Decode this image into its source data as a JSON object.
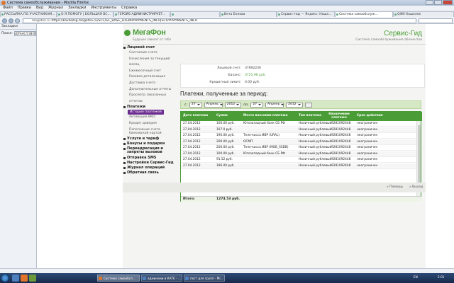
{
  "window": {
    "title": "Система самообслуживания - Mozilla Firefox"
  },
  "menu": [
    "Файл",
    "Правка",
    "Вид",
    "Журнал",
    "Закладки",
    "Инструменты",
    "Справка"
  ],
  "tabs": [
    {
      "label": "РАССЫЛКА ПО УЧАСТНИКАМ...",
      "active": false
    },
    {
      "label": "О Я ПОМОГУ | БОЛЬШАЯ ВС...",
      "active": false
    },
    {
      "label": "ГЕРОЙ0 АДМИНИСТРИРУЕТ...",
      "active": false
    },
    {
      "label": "",
      "active": false
    },
    {
      "label": "Вета Белова",
      "active": false
    },
    {
      "label": "Сервис-гид — Яндекс: Нашл...",
      "active": false
    },
    {
      "label": "Система самообслуж...",
      "active": true
    },
    {
      "label": "QIWI Кошелек",
      "active": false
    }
  ],
  "nav": {
    "host": "megafon.ru",
    "url": "https://kavkazsg.megafon.ru/SCC/SC_BASE_LOGIN#PAYMENTS_INFO|SCP/#PAYMENTS_INFO"
  },
  "sidebar": {
    "title": "Закладки",
    "search_label": "Поиск:",
    "search_value": "sDl%AC/1383051862495I"
  },
  "brand": {
    "name": "МегаФон",
    "slogan": "Будущее зависит от тебя",
    "service": "Сервис-Гид",
    "service_sub": "Система самообслуживания абонентов"
  },
  "left_menu": [
    {
      "head": "Лицевой счет",
      "items": [
        {
          "label": "Состояние счета"
        },
        {
          "label": "Начисления за текущий месяц"
        },
        {
          "label": "Ежемесячный счет"
        },
        {
          "label": "Разовая детализация"
        },
        {
          "label": "Доставка счета"
        },
        {
          "label": "Дополнительные отчеты"
        },
        {
          "label": "Просмотр заказанных отчетов"
        }
      ]
    },
    {
      "head": "Платежи",
      "items": [
        {
          "label": "История платежей",
          "active": true
        },
        {
          "label": "Активация ВКО"
        },
        {
          "label": "Кредит доверия"
        },
        {
          "label": "Пополнение счета банковской картой"
        }
      ]
    },
    {
      "head": "Услуги и тариф",
      "items": []
    },
    {
      "head": "Бонусы и подарки",
      "items": []
    },
    {
      "head": "Переадресация и запреты вызовов",
      "items": []
    },
    {
      "head": "Отправка SMS",
      "items": []
    },
    {
      "head": "Настройки Сервис-Гид",
      "items": []
    },
    {
      "head": "Журнал операций",
      "items": []
    },
    {
      "head": "Обратная связь",
      "items": []
    }
  ],
  "account": {
    "rows": [
      {
        "k": "Лицевой счет:",
        "v": "37892236",
        "green": false
      },
      {
        "k": "Баланс:",
        "v": "3725.96 руб.",
        "green": true
      },
      {
        "k": "Кредитный лимит:",
        "v": "0.00 руб.",
        "green": false
      }
    ]
  },
  "payments": {
    "heading": "Платежи, полученные за период:",
    "filter": {
      "from_label": "с:",
      "to_label": "по:",
      "from_day": "27",
      "from_month": "Апрель",
      "from_year": "2012",
      "to_day": "27",
      "to_month": "Апрель",
      "to_year": "2012"
    },
    "columns": [
      "Дата платежа",
      "Сумма",
      "Место внесения платежа",
      "Тип платежа",
      "Назначение платежа",
      "Срок действия"
    ],
    "rows": [
      [
        "27.04.2012",
        "100.00 руб.",
        "Югозападный банк СБ РФ",
        "Наличный рублевый",
        "9281092448",
        "неограничен"
      ],
      [
        "27.04.2012",
        "107.0 руб.",
        "",
        "Наличный рублевый",
        "9281092448",
        "неограничен"
      ],
      [
        "27.04.2012",
        "190.00 руб.",
        "Теле-касса ИВР (URAL)",
        "Наличный рублевый",
        "9281092448",
        "неограничен"
      ],
      [
        "27.04.2012",
        "200.00 руб.",
        "ОСМП",
        "Наличный рублевый",
        "9281092448",
        "неограничен"
      ],
      [
        "27.04.2012",
        "200.00 руб.",
        "Теле-касса ИВР (МОВ_SSDB)",
        "Наличный рублевый",
        "9281092448",
        "неограничен"
      ],
      [
        "27.04.2012",
        "100.00 руб.",
        "Югозападный банк СБ РФ",
        "Наличный рублевый",
        "9281092448",
        "неограничен"
      ],
      [
        "27.04.2012",
        "91.52 руб.",
        "",
        "Наличный рублевый",
        "9281092448",
        "неограничен"
      ],
      [
        "27.04.2012",
        "186.00 руб.",
        "",
        "Наличный рублевый",
        "9281092448",
        "неограничен"
      ]
    ],
    "total_label": "Итого:",
    "total": "1274.53 руб."
  },
  "footer": {
    "help": "» Помощь",
    "logout": "» Выход"
  },
  "taskbar": {
    "tasks": [
      {
        "label": "Система самообсл...",
        "active": true
      },
      {
        "label": "админами в КАТЕ - ...",
        "active": false
      },
      {
        "label": "пост для групп - Mi...",
        "active": false
      }
    ],
    "lang": "EN",
    "clock": "2:01"
  },
  "colors": {
    "brand_green": "#4a9d36",
    "active_menu": "#6a2d8f",
    "taskbar": "#17294a"
  }
}
